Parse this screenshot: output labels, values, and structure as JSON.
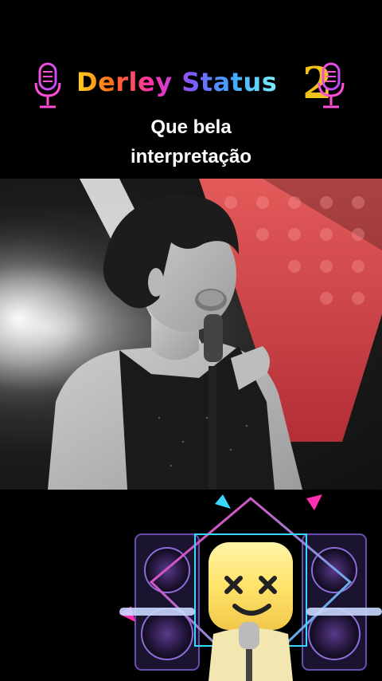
{
  "brand": {
    "title": "Derley Status",
    "number": "2",
    "left_icon": "microphone-icon",
    "right_icon": "microphone-icon"
  },
  "caption": {
    "line1": "Que bela",
    "line2": "interpretação"
  },
  "media": {
    "video": "singer-performance-frame",
    "sticker": "marshmello-dj-sticker"
  },
  "colors": {
    "background": "#000000",
    "caption_text": "#ffffff",
    "brand_gold": "#f3c21b",
    "stage_red": "#d94a4a",
    "neon_pink": "#ff2fb0",
    "neon_cyan": "#39d6ff"
  }
}
